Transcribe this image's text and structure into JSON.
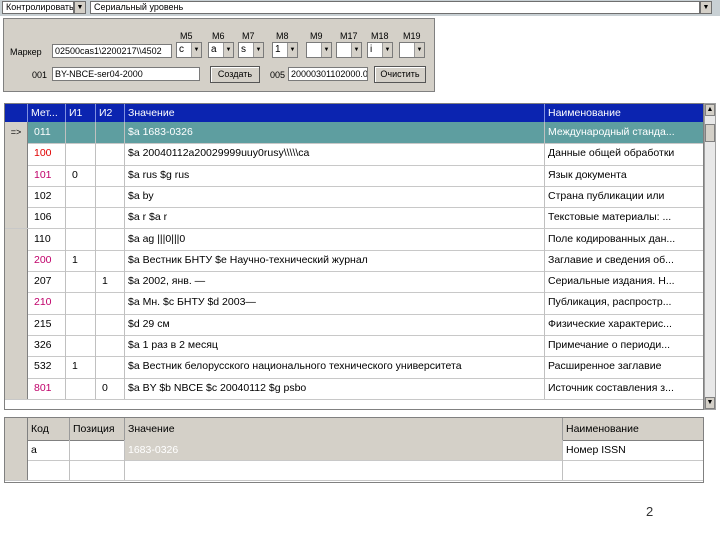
{
  "topbar": {
    "control_combo": "Контролировать по",
    "level_combo": "Сериальный уровень"
  },
  "marker_panel": {
    "marker_label": "Маркер",
    "marker_value": "02500cas1\\2200217\\\\4502",
    "field001_label": "001",
    "field001_value": "BY-NBCE-ser04-2000",
    "create_button": "Создать",
    "field005_label": "005",
    "field005_value": "20000301102000.0",
    "clear_button": "Очистить",
    "positions": [
      {
        "label": "M5",
        "value": "c"
      },
      {
        "label": "M6",
        "value": "a"
      },
      {
        "label": "M7",
        "value": "s"
      },
      {
        "label": "M8",
        "value": "1"
      },
      {
        "label": "M9",
        "value": ""
      },
      {
        "label": "M17",
        "value": ""
      },
      {
        "label": "M18",
        "value": "i"
      },
      {
        "label": "M19",
        "value": ""
      }
    ]
  },
  "fields_grid": {
    "columns": [
      "Мет...",
      "И1",
      "И2",
      "Значение",
      "Наименование"
    ],
    "rows": [
      {
        "indicator": "=>",
        "tag": "011",
        "i1": "",
        "i2": "",
        "value": "$a 1683-0326",
        "name": "Международный станда...",
        "tag_color": "#000000",
        "selected": true
      },
      {
        "indicator": "",
        "tag": "100",
        "i1": "",
        "i2": "",
        "value": "$a 20040112a20029999uuy0rusy\\\\\\\\\\ca",
        "name": "Данные общей обработки",
        "tag_color": "#e00000",
        "selected": false
      },
      {
        "indicator": "",
        "tag": "101",
        "i1": "0",
        "i2": "",
        "value": "$a rus $g rus",
        "name": "Язык документа",
        "tag_color": "#c0006a",
        "selected": false
      },
      {
        "indicator": "",
        "tag": "102",
        "i1": "",
        "i2": "",
        "value": "$a by",
        "name": "Страна публикации или",
        "tag_color": "#000000",
        "selected": false
      },
      {
        "indicator": "",
        "tag": "106",
        "i1": "",
        "i2": "",
        "value": "$a r $a r",
        "name": "Текстовые материалы: ...",
        "tag_color": "#000000",
        "selected": false
      },
      {
        "indicator": "",
        "tag": "110",
        "i1": "",
        "i2": "",
        "value": "$a ag |||0|||0",
        "name": "Поле кодированных дан...",
        "tag_color": "#000000",
        "selected": false
      },
      {
        "indicator": "",
        "tag": "200",
        "i1": "1",
        "i2": "",
        "value": "$a Вестник БНТУ $e Научно-технический журнал",
        "name": "Заглавие и сведения об...",
        "tag_color": "#c0006a",
        "selected": false
      },
      {
        "indicator": "",
        "tag": "207",
        "i1": "",
        "i2": "1",
        "value": "$a 2002, янв. —",
        "name": "Сериальные издания. Н...",
        "tag_color": "#000000",
        "selected": false
      },
      {
        "indicator": "",
        "tag": "210",
        "i1": "",
        "i2": "",
        "value": "$a Мн. $c БНТУ $d 2003—",
        "name": "Публикация, распростр...",
        "tag_color": "#c0006a",
        "selected": false
      },
      {
        "indicator": "",
        "tag": "215",
        "i1": "",
        "i2": "",
        "value": "$d 29 см",
        "name": "Физические характерис...",
        "tag_color": "#000000",
        "selected": false
      },
      {
        "indicator": "",
        "tag": "326",
        "i1": "",
        "i2": "",
        "value": "$a 1 раз в 2 месяц",
        "name": "Примечание о периоди...",
        "tag_color": "#000000",
        "selected": false
      },
      {
        "indicator": "",
        "tag": "532",
        "i1": "1",
        "i2": "",
        "value": "$a Вестник белорусского национального технического университета",
        "name": "Расширенное заглавие",
        "tag_color": "#000000",
        "selected": false
      },
      {
        "indicator": "",
        "tag": "801",
        "i1": "",
        "i2": "0",
        "value": "$a BY $b NBCE $c 20040112 $g psbo",
        "name": "Источник составления з...",
        "tag_color": "#c0006a",
        "selected": false
      }
    ]
  },
  "subfield_grid": {
    "columns": [
      "Код",
      "Позиция",
      "Значение",
      "Наименование"
    ],
    "rows": [
      {
        "code": "a",
        "position": "",
        "value": "1683-0326",
        "name": "Номер ISSN"
      }
    ]
  },
  "scroll": {
    "up": "▲",
    "down": "▼"
  },
  "page_number": "2"
}
